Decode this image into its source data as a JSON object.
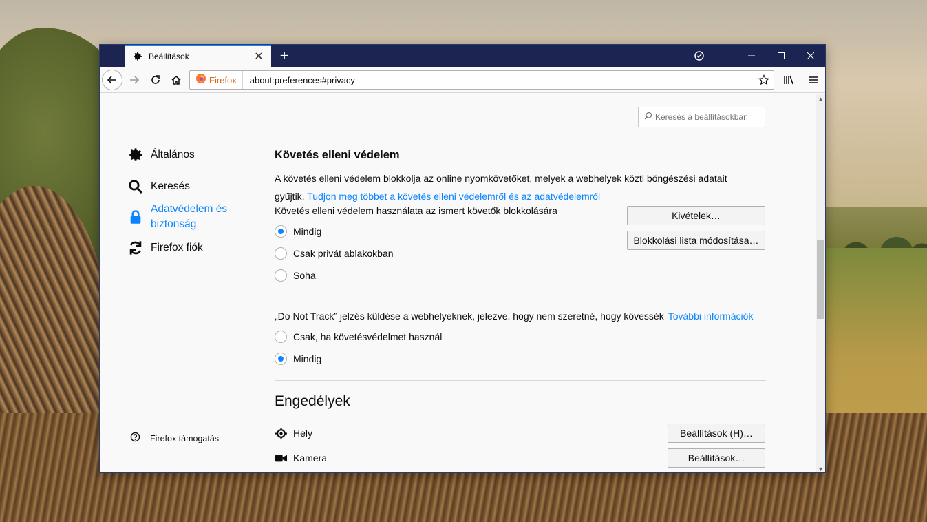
{
  "window": {
    "tab_title": "Beállítások",
    "tab_icon": "gear-icon"
  },
  "navbar": {
    "identity_label": "Firefox",
    "url": "about:preferences#privacy"
  },
  "search": {
    "placeholder": "Keresés a beállításokban"
  },
  "sidebar": {
    "items": [
      {
        "label": "Általános",
        "icon": "gear-icon",
        "active": false
      },
      {
        "label": "Keresés",
        "icon": "search-icon",
        "active": false
      },
      {
        "label": "Adatvédelem és biztonság",
        "icon": "lock-icon",
        "active": true
      },
      {
        "label": "Firefox fiók",
        "icon": "sync-icon",
        "active": false
      }
    ],
    "support_label": "Firefox támogatás"
  },
  "tracking": {
    "heading": "Követés elleni védelem",
    "description": "A követés elleni védelem blokkolja az online nyomkövetőket, melyek a webhelyek közti böngészési adatait gyűjtik.",
    "learn_more": "Tudjon meg többet a követés elleni védelemről és az adatvédelemről",
    "use_label": "Követés elleni védelem használata az ismert követők blokkolására",
    "options": [
      {
        "label": "Mindig",
        "checked": true
      },
      {
        "label": "Csak privát ablakokban",
        "checked": false
      },
      {
        "label": "Soha",
        "checked": false
      }
    ],
    "exceptions_button": "Kivételek…",
    "blocklist_button": "Blokkolási lista módosítása…"
  },
  "dnt": {
    "label": "„Do Not Track” jelzés küldése a webhelyeknek, jelezve, hogy nem szeretné, hogy kövessék",
    "more_info": "További információk",
    "options": [
      {
        "label": "Csak, ha követésvédelmet használ",
        "checked": false
      },
      {
        "label": "Mindig",
        "checked": true
      }
    ]
  },
  "permissions": {
    "heading": "Engedélyek",
    "items": [
      {
        "label": "Hely",
        "icon": "location-icon",
        "button": "Beállítások (H)…"
      },
      {
        "label": "Kamera",
        "icon": "camera-icon",
        "button": "Beállítások…"
      }
    ]
  },
  "colors": {
    "accent": "#0a84ff",
    "titlebar": "#1c2451",
    "firefox_orange": "#d7630d"
  }
}
